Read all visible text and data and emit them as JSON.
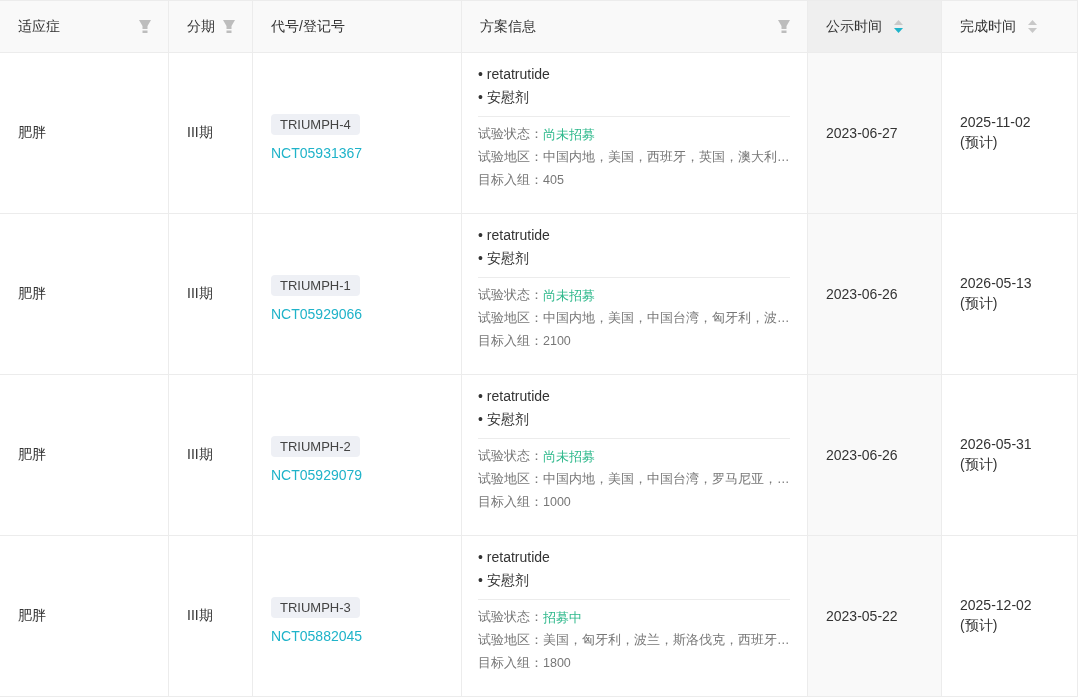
{
  "columns": [
    {
      "label": "适应症",
      "filter": true,
      "sortable": false,
      "sorted_descending": false
    },
    {
      "label": "分期",
      "filter": true,
      "sortable": false,
      "sorted_descending": false
    },
    {
      "label": "代号/登记号",
      "filter": false,
      "sortable": false,
      "sorted_descending": false
    },
    {
      "label": "方案信息",
      "filter": true,
      "sortable": false,
      "sorted_descending": false
    },
    {
      "label": "公示时间",
      "filter": false,
      "sortable": true,
      "sorted_descending": true
    },
    {
      "label": "完成时间",
      "filter": false,
      "sortable": true,
      "sorted_descending": false
    }
  ],
  "rows": [
    {
      "indication": "肥胖",
      "phase": "III期",
      "code": "TRIUMPH-4",
      "registry": "NCT05931367",
      "drugs": [
        "• retatrutide",
        "• 安慰剂"
      ],
      "status_label": "试验状态：",
      "status": "尚未招募",
      "region_label": "试验地区：",
      "region": "中国内地，美国，西班牙，英国，澳大利…",
      "enroll_label": "目标入组：",
      "enroll": "405",
      "published": "2023-06-27",
      "completion": "2025-11-02",
      "completion_note": "(预计)"
    },
    {
      "indication": "肥胖",
      "phase": "III期",
      "code": "TRIUMPH-1",
      "registry": "NCT05929066",
      "drugs": [
        "• retatrutide",
        "• 安慰剂"
      ],
      "status_label": "试验状态：",
      "status": "尚未招募",
      "region_label": "试验地区：",
      "region": "中国内地，美国，中国台湾，匈牙利，波…",
      "enroll_label": "目标入组：",
      "enroll": "2100",
      "published": "2023-06-26",
      "completion": "2026-05-13",
      "completion_note": "(预计)"
    },
    {
      "indication": "肥胖",
      "phase": "III期",
      "code": "TRIUMPH-2",
      "registry": "NCT05929079",
      "drugs": [
        "• retatrutide",
        "• 安慰剂"
      ],
      "status_label": "试验状态：",
      "status": "尚未招募",
      "region_label": "试验地区：",
      "region": "中国内地，美国，中国台湾，罗马尼亚，…",
      "enroll_label": "目标入组：",
      "enroll": "1000",
      "published": "2023-06-26",
      "completion": "2026-05-31",
      "completion_note": "(预计)"
    },
    {
      "indication": "肥胖",
      "phase": "III期",
      "code": "TRIUMPH-3",
      "registry": "NCT05882045",
      "drugs": [
        "• retatrutide",
        "• 安慰剂"
      ],
      "status_label": "试验状态：",
      "status": "招募中",
      "region_label": "试验地区：",
      "region": "美国，匈牙利，波兰，斯洛伐克，西班牙…",
      "enroll_label": "目标入组：",
      "enroll": "1800",
      "published": "2023-05-22",
      "completion": "2025-12-02",
      "completion_note": "(预计)"
    }
  ]
}
